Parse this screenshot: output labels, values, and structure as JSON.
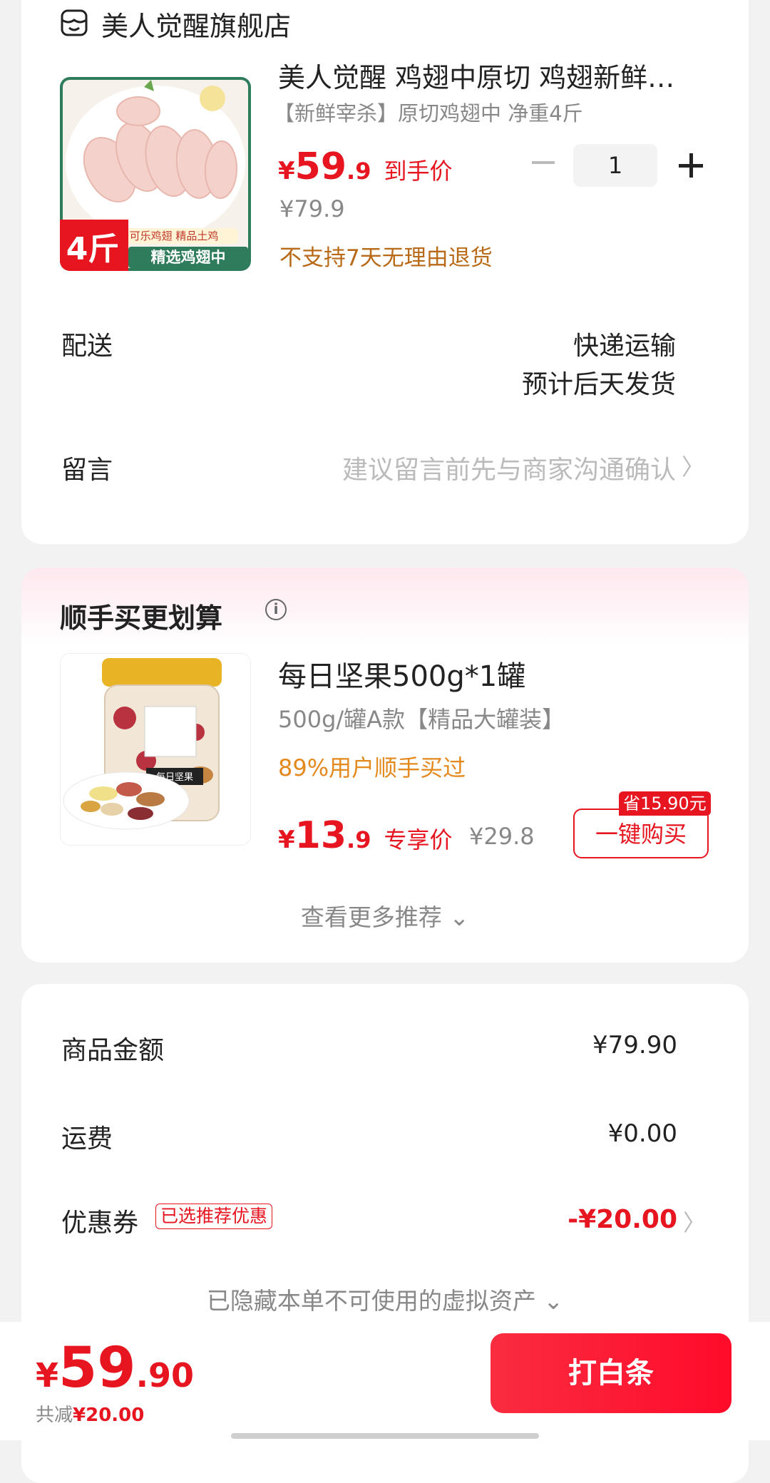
{
  "store": {
    "name": "美人觉醒旗舰店"
  },
  "product": {
    "title": "美人觉醒 鸡翅中原切 鸡翅新鲜…",
    "spec": "【新鲜宰杀】原切鸡翅中 净重4斤",
    "price_yen": "¥",
    "price_int": "59",
    "price_dec": ".9",
    "price_tag": "到手价",
    "original_price": "¥79.9",
    "return_note": "不支持7天无理由退货",
    "quantity": "1",
    "image_texts": {
      "weight_badge": "4斤",
      "banner": "精选鸡翅中",
      "subtitle": "可乐鸡翅 精品土鸡"
    }
  },
  "delivery": {
    "label": "配送",
    "method": "快递运输",
    "eta": "预计后天发货"
  },
  "message": {
    "label": "留言",
    "placeholder": "建议留言前先与商家沟通确认",
    "chevron": "〉"
  },
  "recommendation": {
    "section_title": "顺手买更划算",
    "item": {
      "name": "每日坚果500g*1罐",
      "spec": "500g/罐A款【精品大罐装】",
      "social_proof": "89%用户顺手买过",
      "price_yen": "¥",
      "price_int": "13",
      "price_dec": ".9",
      "price_tag": "专享价",
      "original_price": "¥29.8",
      "buy_label": "一键购买",
      "save_badge": "省15.90元",
      "jar_label": "每日坚果"
    },
    "more_label": "查看更多推荐 ⌄"
  },
  "summary": {
    "goods_label": "商品金额",
    "goods_value": "¥79.90",
    "shipping_label": "运费",
    "shipping_value": "¥0.00",
    "coupon_label": "优惠券",
    "coupon_badge": "已选推荐优惠",
    "coupon_value": "-¥20.00",
    "coupon_chevron": "〉",
    "hidden_note": "已隐藏本单不可使用的虚拟资产 ⌄"
  },
  "bottom_bar": {
    "total_yen": "¥",
    "total_int": "59",
    "total_dec": ".90",
    "save_prefix": "共减",
    "save_amount": "¥20.00",
    "pay_button": "打白条"
  },
  "colors": {
    "accent_red": "#e6151f",
    "orange_note": "#b96a18"
  }
}
